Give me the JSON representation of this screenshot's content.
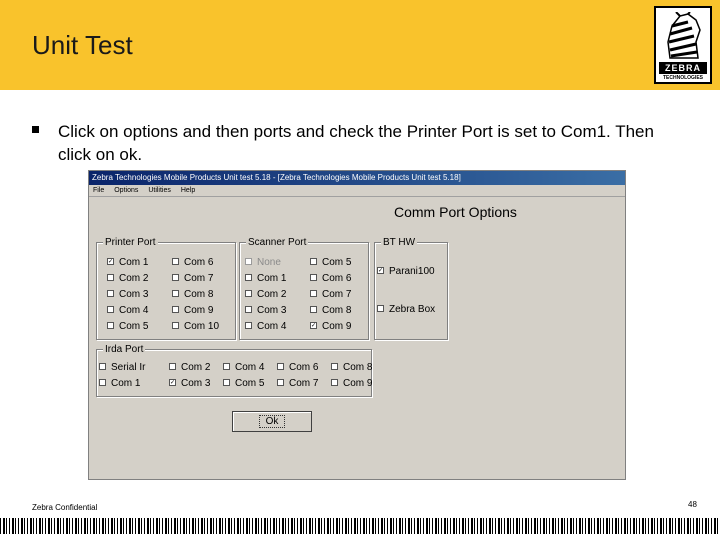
{
  "slide": {
    "title": "Unit Test",
    "logo_text": "ZEBRA",
    "logo_subtext": "TECHNOLOGIES",
    "bullet": "Click on options and then ports and check the Printer Port is set to Com1. Then click on ok.",
    "footer_left": "Zebra Confidential",
    "page_number": "48"
  },
  "window": {
    "title": "Zebra Technologies Mobile Products Unit test 5.18 - [Zebra Technologies Mobile Products Unit test 5.18]",
    "menu": [
      "File",
      "Options",
      "Utilities",
      "Help"
    ],
    "heading": "Comm Port Options",
    "printer_port": {
      "label": "Printer Port",
      "items": [
        {
          "label": "Com 1",
          "checked": true
        },
        {
          "label": "Com 2"
        },
        {
          "label": "Com 3"
        },
        {
          "label": "Com 4"
        },
        {
          "label": "Com 5"
        },
        {
          "label": "Com 6"
        },
        {
          "label": "Com 7"
        },
        {
          "label": "Com 8"
        },
        {
          "label": "Com 9"
        },
        {
          "label": "Com 10"
        }
      ]
    },
    "scanner_port": {
      "label": "Scanner Port",
      "items": [
        {
          "label": "None",
          "disabled": true
        },
        {
          "label": "Com 1"
        },
        {
          "label": "Com 2"
        },
        {
          "label": "Com 3"
        },
        {
          "label": "Com 4"
        },
        {
          "label": "Com 5"
        },
        {
          "label": "Com 6"
        },
        {
          "label": "Com 7"
        },
        {
          "label": "Com 8"
        },
        {
          "label": "Com 9",
          "checked": true
        }
      ]
    },
    "bt_hw": {
      "label": "BT HW",
      "items": [
        {
          "label": "Parani100",
          "checked": true
        },
        {
          "label": "Zebra Box"
        }
      ]
    },
    "irda_port": {
      "label": "Irda Port",
      "items": [
        {
          "label": "Serial Ir"
        },
        {
          "label": "Com 1"
        },
        {
          "label": "Com 2"
        },
        {
          "label": "Com 3",
          "checked": true
        },
        {
          "label": "Com 4"
        },
        {
          "label": "Com 5"
        },
        {
          "label": "Com 6"
        },
        {
          "label": "Com 7"
        },
        {
          "label": "Com 8"
        },
        {
          "label": "Com 9"
        }
      ]
    },
    "ok_label": "Ok"
  },
  "colors": {
    "header": "#f9c32c",
    "window_bg": "#d4d0c8",
    "title_bar": "#0a246a"
  }
}
